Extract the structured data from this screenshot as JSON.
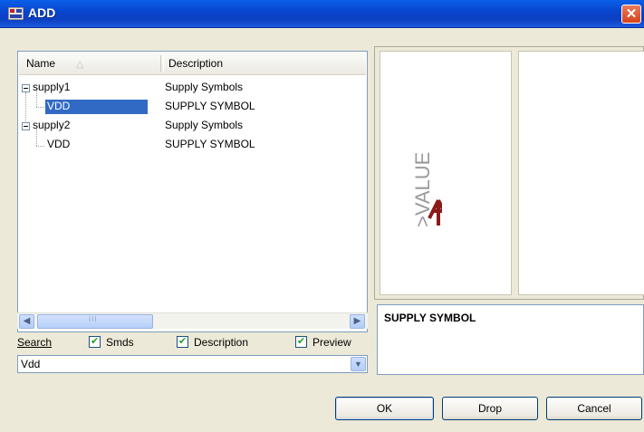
{
  "window": {
    "title": "ADD"
  },
  "tree": {
    "headers": {
      "name": "Name",
      "description": "Description"
    },
    "rows": [
      {
        "name": "supply1",
        "description": "Supply Symbols"
      },
      {
        "name": "VDD",
        "description": "SUPPLY SYMBOL"
      },
      {
        "name": "supply2",
        "description": "Supply Symbols"
      },
      {
        "name": "VDD",
        "description": "SUPPLY SYMBOL"
      }
    ]
  },
  "scrollbar": {
    "grip": "III"
  },
  "options": {
    "search_label": "Search",
    "smds_label": "Smds",
    "description_label": "Description",
    "preview_label": "Preview"
  },
  "search": {
    "value": "Vdd"
  },
  "preview": {
    "value_text": ">VALUE",
    "description": "SUPPLY SYMBOL",
    "symbol_color": "#8b1a1a"
  },
  "buttons": {
    "ok": "OK",
    "drop": "Drop",
    "cancel": "Cancel"
  },
  "colors": {
    "selection": "#316ac5",
    "titlebar": "#0846d0"
  }
}
